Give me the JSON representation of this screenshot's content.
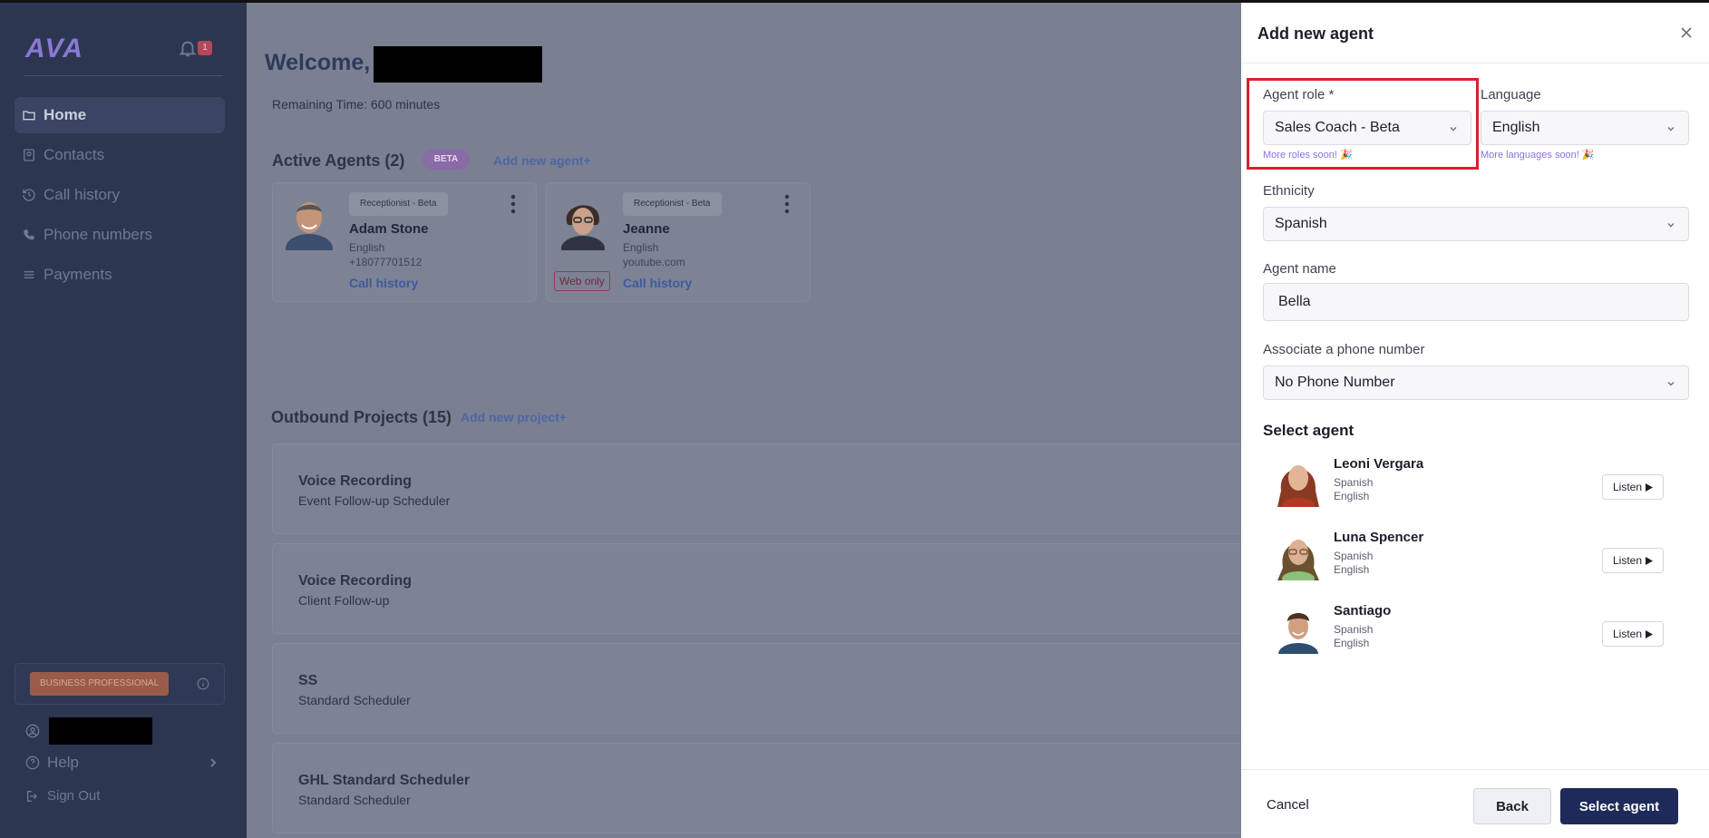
{
  "app": {
    "logo": "AVA",
    "notification_count": "1"
  },
  "sidebar": {
    "items": [
      {
        "label": "Home",
        "icon": "folder-icon",
        "active": true
      },
      {
        "label": "Contacts",
        "icon": "contacts-icon",
        "active": false
      },
      {
        "label": "Call history",
        "icon": "history-icon",
        "active": false
      },
      {
        "label": "Phone numbers",
        "icon": "phone-icon",
        "active": false
      },
      {
        "label": "Payments",
        "icon": "payments-icon",
        "active": false
      }
    ],
    "plan_badge": "BUSINESS PROFESSIONAL",
    "help_label": "Help",
    "signout_label": "Sign Out"
  },
  "main": {
    "welcome": "Welcome,",
    "remaining_time": "Remaining Time: 600 minutes",
    "active_agents_title": "Active Agents (2)",
    "beta_label": "BETA",
    "add_agent_link": "Add new agent+",
    "agents": [
      {
        "role": "Receptionist - Beta",
        "name": "Adam Stone",
        "language": "English",
        "contact": "+18077701512",
        "call_history": "Call history",
        "web_only": ""
      },
      {
        "role": "Receptionist - Beta",
        "name": "Jeanne",
        "language": "English",
        "contact": "youtube.com",
        "call_history": "Call history",
        "web_only": "Web only"
      }
    ],
    "outbound_title": "Outbound Projects (15)",
    "add_project_link": "Add new project+",
    "projects": [
      {
        "title": "Voice Recording",
        "subtitle": "Event Follow-up Scheduler"
      },
      {
        "title": "Voice Recording",
        "subtitle": "Client Follow-up"
      },
      {
        "title": "SS",
        "subtitle": "Standard Scheduler"
      },
      {
        "title": "GHL Standard Scheduler",
        "subtitle": "Standard Scheduler"
      }
    ]
  },
  "drawer": {
    "title": "Add new agent",
    "agent_role": {
      "label": "Agent role *",
      "value": "Sales Coach - Beta",
      "hint": "More roles soon! 🎉"
    },
    "language": {
      "label": "Language",
      "value": "English",
      "hint": "More languages soon! 🎉"
    },
    "ethnicity": {
      "label": "Ethnicity",
      "value": "Spanish"
    },
    "agent_name": {
      "label": "Agent name",
      "value": "Bella"
    },
    "phone": {
      "label": "Associate a phone number",
      "value": "No Phone Number"
    },
    "select_agent_title": "Select agent",
    "voices": [
      {
        "name": "Leoni Vergara",
        "lang1": "Spanish",
        "lang2": "English",
        "listen": "Listen"
      },
      {
        "name": "Luna Spencer",
        "lang1": "Spanish",
        "lang2": "English",
        "listen": "Listen"
      },
      {
        "name": "Santiago",
        "lang1": "Spanish",
        "lang2": "English",
        "listen": "Listen"
      }
    ],
    "cancel": "Cancel",
    "back": "Back",
    "select_agent_button": "Select agent"
  },
  "colors": {
    "accent": "#8b6fe0",
    "primary_button": "#1d2a5a",
    "highlight": "#d91e2d",
    "sidebar": "#2c3650"
  }
}
